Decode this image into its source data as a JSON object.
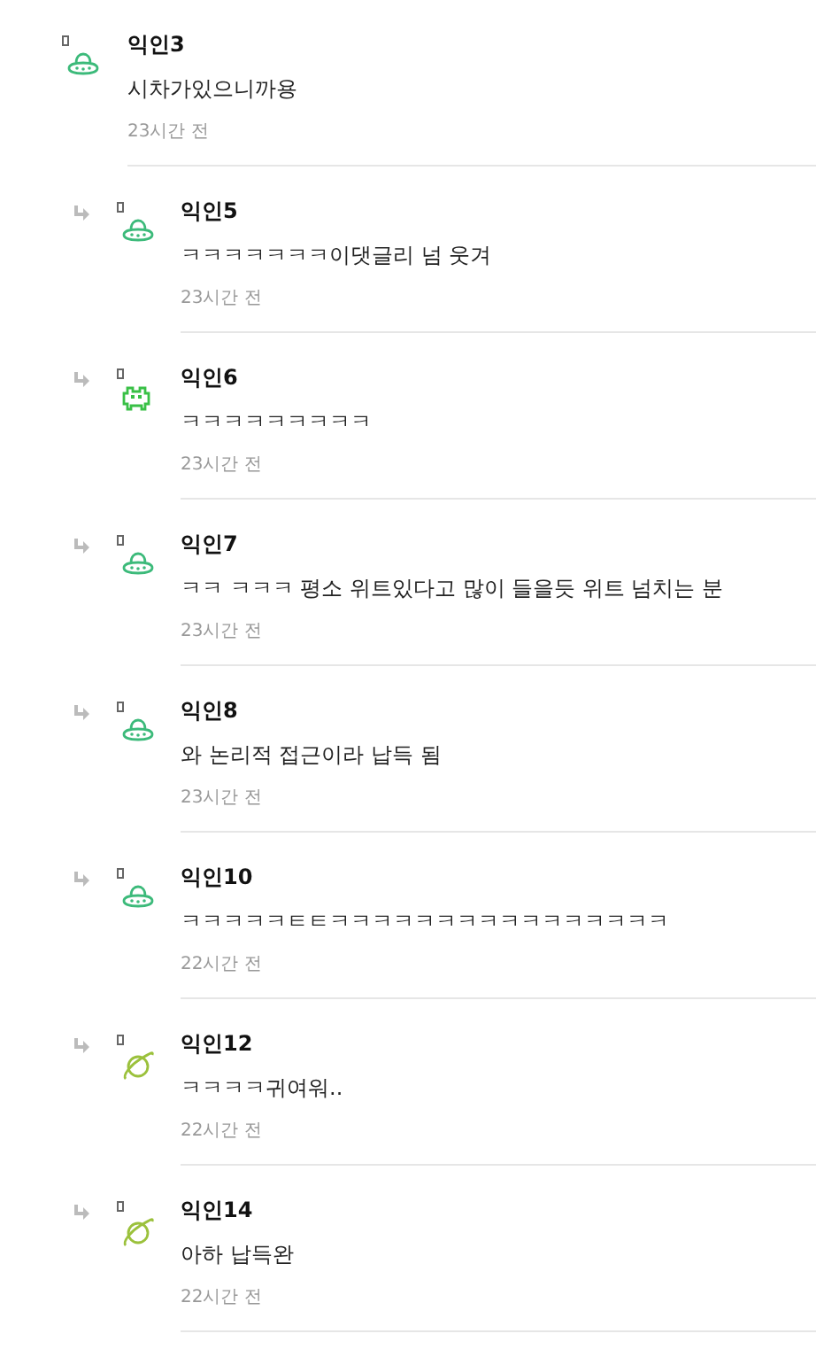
{
  "comments": [
    {
      "reply": false,
      "kind": "ufo",
      "name": "익인3",
      "text": "시차가있으니까용",
      "time": "23시간 전"
    },
    {
      "reply": true,
      "kind": "ufo",
      "name": "익인5",
      "text": "ㅋㅋㅋㅋㅋㅋㅋ이댓글리 넘 웃겨",
      "time": "23시간 전"
    },
    {
      "reply": true,
      "kind": "robot",
      "name": "익인6",
      "text": "ㅋㅋㅋㅋㅋㅋㅋㅋㅋ",
      "time": "23시간 전"
    },
    {
      "reply": true,
      "kind": "ufo",
      "name": "익인7",
      "text": "ㅋㅋ ㅋㅋㅋ 평소 위트있다고 많이 들을듯 위트 넘치는 분",
      "time": "23시간 전"
    },
    {
      "reply": true,
      "kind": "ufo",
      "name": "익인8",
      "text": "와 논리적 접근이라 납득 됨",
      "time": "23시간 전"
    },
    {
      "reply": true,
      "kind": "ufo",
      "name": "익인10",
      "text": "ㅋㅋㅋㅋㅋㅌㅌㅋㅋㅋㅋㅋㅋㅋㅋㅋㅋㅋㅋㅋㅋㅋㅋ",
      "time": "22시간 전"
    },
    {
      "reply": true,
      "kind": "planet",
      "name": "익인12",
      "text": "ㅋㅋㅋㅋ귀여워..",
      "time": "22시간 전"
    },
    {
      "reply": true,
      "kind": "planet",
      "name": "익인14",
      "text": "아하 납득완",
      "time": "22시간 전"
    }
  ]
}
